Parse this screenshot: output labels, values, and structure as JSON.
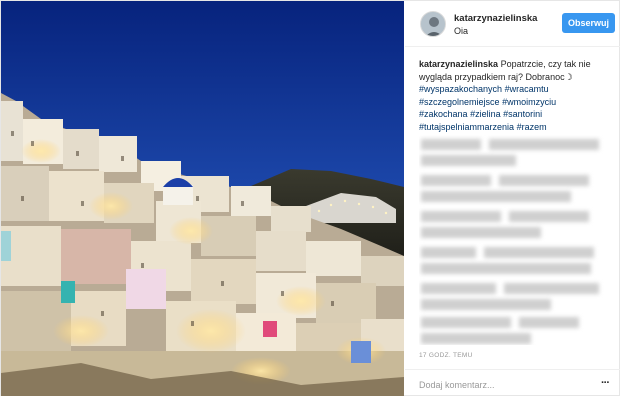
{
  "post": {
    "username": "katarzynazielinska",
    "location": "Oia",
    "follow_label": "Obserwuj",
    "caption_text": "Popatrzcie, czy tak nie wygląda przypadkiem raj? Dobranoc",
    "moon_glyph": "☽",
    "hashtags": [
      "#wyspazakochanych",
      "#wracamtu",
      "#szczegolnemiejsce",
      "#wmoimzyciu",
      "#zakochana",
      "#zielina",
      "#santorini",
      "#tutajspelniammarzenia",
      "#razem"
    ],
    "timestamp": "17 GODZ. TEMU",
    "comment_placeholder": "Dodaj komentarz...",
    "more_icon": "···"
  },
  "colors": {
    "follow_button": "#3897f0",
    "hashtag": "#003569",
    "sky_top": "#0a2a8a",
    "sky_bottom": "#2f5fc4"
  }
}
